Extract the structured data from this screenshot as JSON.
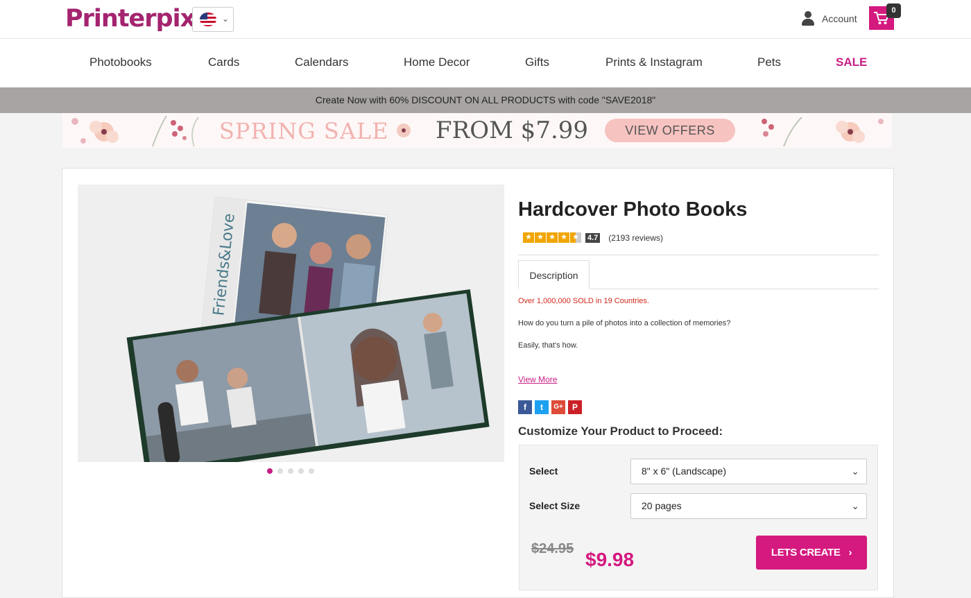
{
  "header": {
    "logo": "Printerpix",
    "account_label": "Account",
    "cart_count": "0",
    "flag_icon": "us-flag-icon"
  },
  "nav": {
    "items": [
      "Photobooks",
      "Cards",
      "Calendars",
      "Home Decor",
      "Gifts",
      "Prints & Instagram",
      "Pets",
      "SALE"
    ]
  },
  "promo": {
    "text": "Create Now with 60% DISCOUNT ON ALL PRODUCTS with code \"SAVE2018\""
  },
  "banner": {
    "sale_text": "SPRING SALE",
    "price_text": "FROM $7.99",
    "button_label": "VIEW OFFERS"
  },
  "product": {
    "title": "Hardcover Photo Books",
    "rating": "4.7",
    "reviews": "(2193 reviews)",
    "tab_label": "Description",
    "sold_text": "Over 1,000,000 SOLD in 19 Countries.",
    "paragraph1": "How do you turn a pile of photos into a collection of memories?",
    "paragraph2": "Easily, that's how.",
    "view_more": "View More",
    "book_cover_text": "Friends&Love",
    "carousel_slides": 5,
    "carousel_active": 1
  },
  "social": {
    "facebook": "f",
    "twitter": "t",
    "google": "G+",
    "pinterest": "P"
  },
  "customize": {
    "heading": "Customize Your Product to Proceed:",
    "select_label": "Select",
    "select_value": "8\" x 6\" (Landscape)",
    "size_label": "Select Size",
    "size_value": "20 pages"
  },
  "pricing": {
    "old_price": "$24.95",
    "new_price": "$9.98",
    "cta_label": "LETS CREATE"
  },
  "colors": {
    "brand": "#d4197f",
    "promo_bg": "#a9a4a4",
    "sold_text": "#d0281c"
  }
}
